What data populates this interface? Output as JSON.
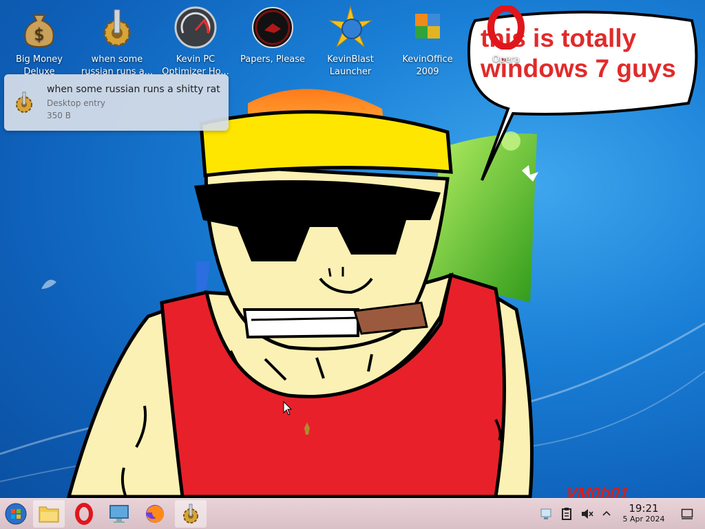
{
  "desktop": {
    "icons": [
      {
        "name": "big-money-deluxe",
        "label": "Big Money Deluxe",
        "icon": "money-bag-icon"
      },
      {
        "name": "russian-rat",
        "label": "when some russian runs a...",
        "icon": "gear-icon"
      },
      {
        "name": "kevin-pc-optimizer",
        "label": "Kevin PC Optimizer Ho...",
        "icon": "speedometer-icon"
      },
      {
        "name": "papers-please",
        "label": "Papers, Please",
        "icon": "papers-please-icon"
      },
      {
        "name": "kevinblast-launcher",
        "label": "KevinBlast Launcher",
        "icon": "star-globe-icon"
      },
      {
        "name": "kevinoffice-2009",
        "label": "KevinOffice 2009",
        "icon": "office-icon"
      },
      {
        "name": "opera",
        "label": "Opera",
        "icon": "opera-icon"
      }
    ],
    "speech_bubble": "this is totally windows 7 guys",
    "watermark": "VM0b01"
  },
  "tooltip": {
    "title": "when some russian runs a shitty rat",
    "type": "Desktop entry",
    "size": "350 B"
  },
  "taskbar": {
    "items": [
      {
        "name": "start-button",
        "icon": "windows-orb-icon"
      },
      {
        "name": "file-manager",
        "icon": "folder-icon"
      },
      {
        "name": "opera",
        "icon": "opera-icon"
      },
      {
        "name": "system-monitor",
        "icon": "monitor-icon"
      },
      {
        "name": "firefox",
        "icon": "firefox-icon"
      },
      {
        "name": "russian-rat-task",
        "icon": "gear-icon",
        "active": true
      }
    ],
    "tray": [
      "network-icon",
      "clipboard-icon",
      "volume-muted-icon",
      "chevron-up-icon"
    ],
    "clock": {
      "time": "19:21",
      "date": "5 Apr 2024"
    },
    "show_desktop_icon": "show-desktop-icon"
  },
  "colors": {
    "bubble_text": "#e12a2a",
    "taskbar": "#e2ccd1",
    "shirt": "#e8202a",
    "headband": "#ffe600",
    "skin": "#fbf1b4"
  }
}
